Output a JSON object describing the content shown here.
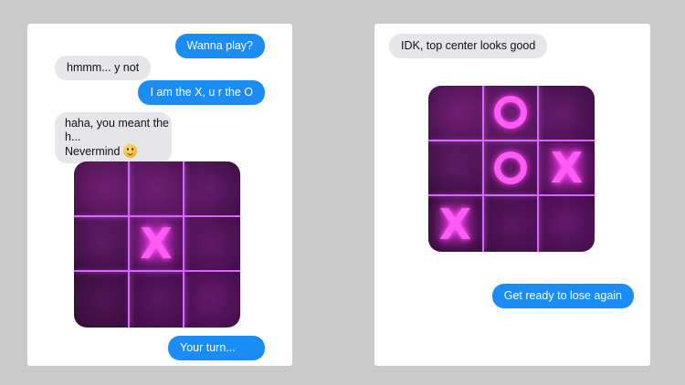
{
  "left_panel": {
    "messages": [
      {
        "side": "sent",
        "text": "Wanna play?"
      },
      {
        "side": "recv",
        "text": "hmmm... y not"
      },
      {
        "side": "sent",
        "text": "I am the X, u r the O"
      },
      {
        "side": "recv",
        "line1": "haha, you meant the h...",
        "line2": "Nevermind",
        "emoji": "grinning-emoji"
      },
      {
        "side": "sent",
        "text": "Your turn..."
      }
    ],
    "board": [
      "",
      "",
      "",
      "",
      "X",
      "",
      "",
      "",
      ""
    ]
  },
  "right_panel": {
    "messages": [
      {
        "side": "recv",
        "text": "IDK, top center looks good"
      },
      {
        "side": "sent",
        "text": "Get ready to lose again"
      }
    ],
    "board": [
      "",
      "O",
      "",
      "",
      "O",
      "X",
      "X",
      "",
      ""
    ]
  },
  "colors": {
    "sent_bubble": "#1b8cf5",
    "received_bubble": "#e5e5ea",
    "neon_mark": "#ff5cf6",
    "grid_line": "#d468ff",
    "board_base": "#3a0f3f"
  }
}
